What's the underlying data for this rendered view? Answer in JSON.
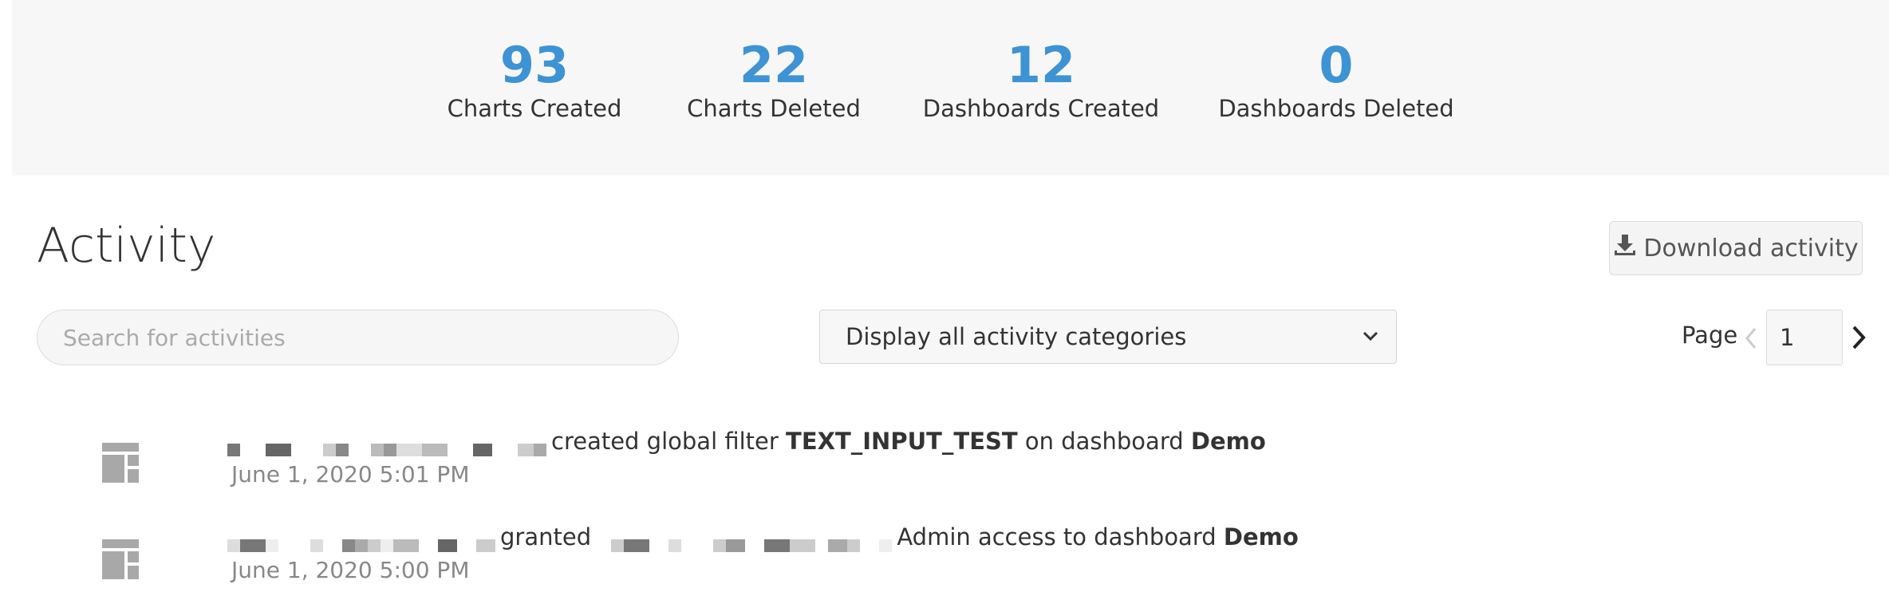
{
  "stats": [
    {
      "value": "93",
      "label": "Charts Created"
    },
    {
      "value": "22",
      "label": "Charts Deleted"
    },
    {
      "value": "12",
      "label": "Dashboards Created"
    },
    {
      "value": "0",
      "label": "Dashboards Deleted"
    }
  ],
  "activity": {
    "title": "Activity",
    "download_label": "Download activity",
    "search_placeholder": "Search for activities",
    "category_select": "Display all activity categories",
    "page_label": "Page",
    "page_value": "1"
  },
  "feed": [
    {
      "action": "created global filter",
      "target": "TEXT_INPUT_TEST",
      "joiner": "on dashboard",
      "object": "Demo",
      "time": "June 1, 2020 5:01 PM"
    },
    {
      "action": "granted",
      "target": "",
      "joiner": "Admin access to dashboard",
      "object": "Demo",
      "time": "June 1, 2020 5:00 PM"
    }
  ],
  "colors": {
    "accent": "#3d93d4",
    "muted": "#888888"
  }
}
